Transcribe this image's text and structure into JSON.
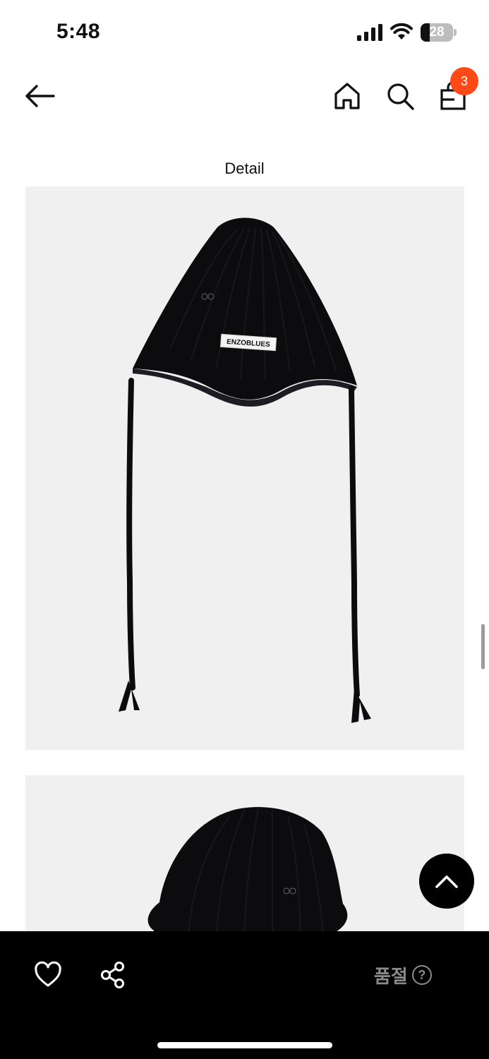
{
  "status_bar": {
    "time": "5:48",
    "battery_level": "28",
    "battery_fraction": 0.28,
    "icons": [
      "signal-icon",
      "wifi-icon",
      "battery-icon"
    ]
  },
  "nav": {
    "icons": [
      "back-arrow-icon",
      "home-icon",
      "search-icon",
      "shopping-bag-icon"
    ],
    "cart_count": "3",
    "badge_color": "#ff4a17"
  },
  "section": {
    "title": "Detail"
  },
  "product_images": [
    {
      "subject": "black knit beanie with ear ties",
      "label_text": "ENZOBLUES",
      "logo_text": "ab"
    },
    {
      "subject": "black knit beanie (back view)",
      "logo_text": "ab"
    }
  ],
  "scroll_top": {
    "icon": "chevron-up-icon"
  },
  "bottom_bar": {
    "icons": [
      "heart-icon",
      "share-icon",
      "help-circle-icon"
    ],
    "status_label": "품절",
    "help_symbol": "?",
    "status_color": "#8a8a8a"
  }
}
